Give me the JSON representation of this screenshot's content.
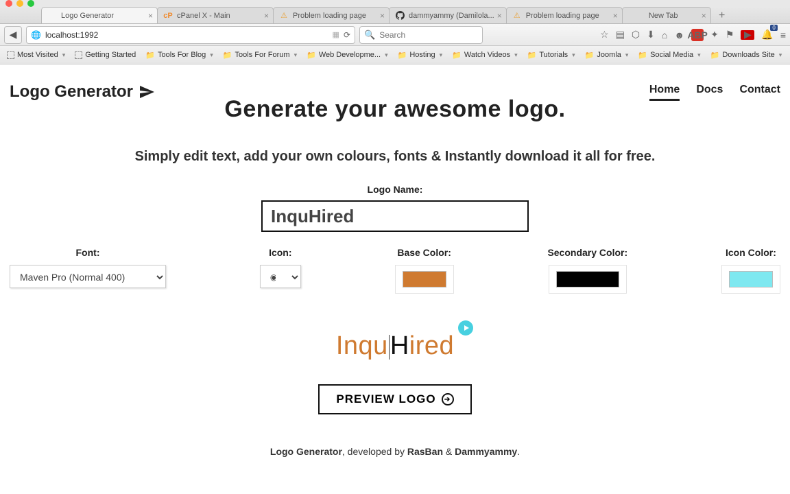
{
  "tabs": [
    {
      "title": "Logo Generator",
      "icon": "blank"
    },
    {
      "title": "cPanel X - Main",
      "icon": "cp"
    },
    {
      "title": "Problem loading page",
      "icon": "warn"
    },
    {
      "title": "dammyammy (Damilola...",
      "icon": "gh"
    },
    {
      "title": "Problem loading page",
      "icon": "warn"
    },
    {
      "title": "New Tab",
      "icon": "none"
    }
  ],
  "url": {
    "value": "localhost:1992"
  },
  "search": {
    "placeholder": "Search"
  },
  "bookmarks": [
    {
      "label": "Most Visited",
      "type": "box"
    },
    {
      "label": "Getting Started",
      "type": "box"
    },
    {
      "label": "Tools For Blog",
      "type": "folder"
    },
    {
      "label": "Tools For Forum",
      "type": "folder"
    },
    {
      "label": "Web Developme...",
      "type": "folder"
    },
    {
      "label": "Hosting",
      "type": "folder"
    },
    {
      "label": "Watch Videos",
      "type": "folder"
    },
    {
      "label": "Tutorials",
      "type": "folder"
    },
    {
      "label": "Joomla",
      "type": "folder"
    },
    {
      "label": "Social Media",
      "type": "folder"
    },
    {
      "label": "Downloads Site",
      "type": "folder"
    }
  ],
  "brand": {
    "name": "Logo Generator"
  },
  "nav": {
    "home": "Home",
    "docs": "Docs",
    "contact": "Contact"
  },
  "hero": {
    "title": "Generate your awesome logo.",
    "subtitle": "Simply edit text, add your own colours, fonts & Instantly download it all for free."
  },
  "form": {
    "logoname_label": "Logo Name:",
    "logoname_value": "InquHired",
    "font_label": "Font:",
    "font_value": "Maven Pro (Normal 400)",
    "icon_label": "Icon:",
    "icon_value": "◉",
    "basecolor_label": "Base Color:",
    "basecolor_value": "#cf7a30",
    "seccolor_label": "Secondary Color:",
    "seccolor_value": "#000000",
    "iconcolor_label": "Icon Color:",
    "iconcolor_value": "#7ee8f0"
  },
  "preview": {
    "part1": "Inqu",
    "part2": "H",
    "part3": "ired",
    "button": "PREVIEW LOGO"
  },
  "footer": {
    "brand": "Logo Generator",
    "mid": ", developed by ",
    "a1": "RasBan",
    "amp": " & ",
    "a2": "Dammyammy",
    "end": "."
  },
  "notification_count": "0"
}
